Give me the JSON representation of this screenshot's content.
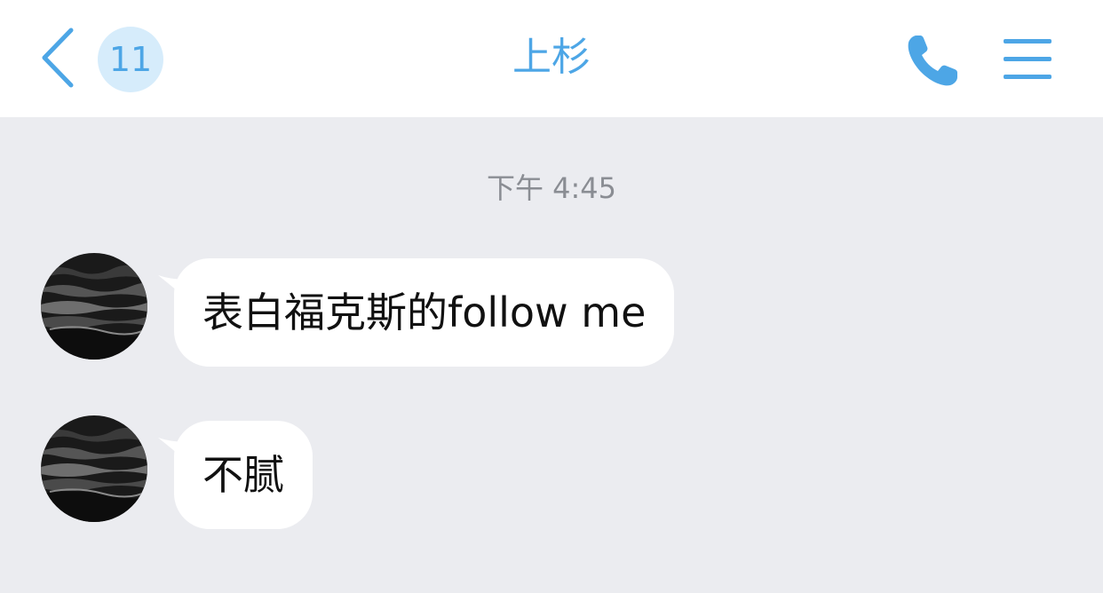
{
  "header": {
    "unread_count": "11",
    "title": "上杉",
    "accent_color": "#4da6e6",
    "icons": {
      "back": "chevron-left-icon",
      "call": "phone-icon",
      "menu": "hamburger-menu-icon"
    }
  },
  "chat": {
    "timestamp": "下午 4:45",
    "messages": [
      {
        "sender": "other",
        "text": "表白福克斯的follow me"
      },
      {
        "sender": "other",
        "text": "不腻"
      }
    ]
  }
}
